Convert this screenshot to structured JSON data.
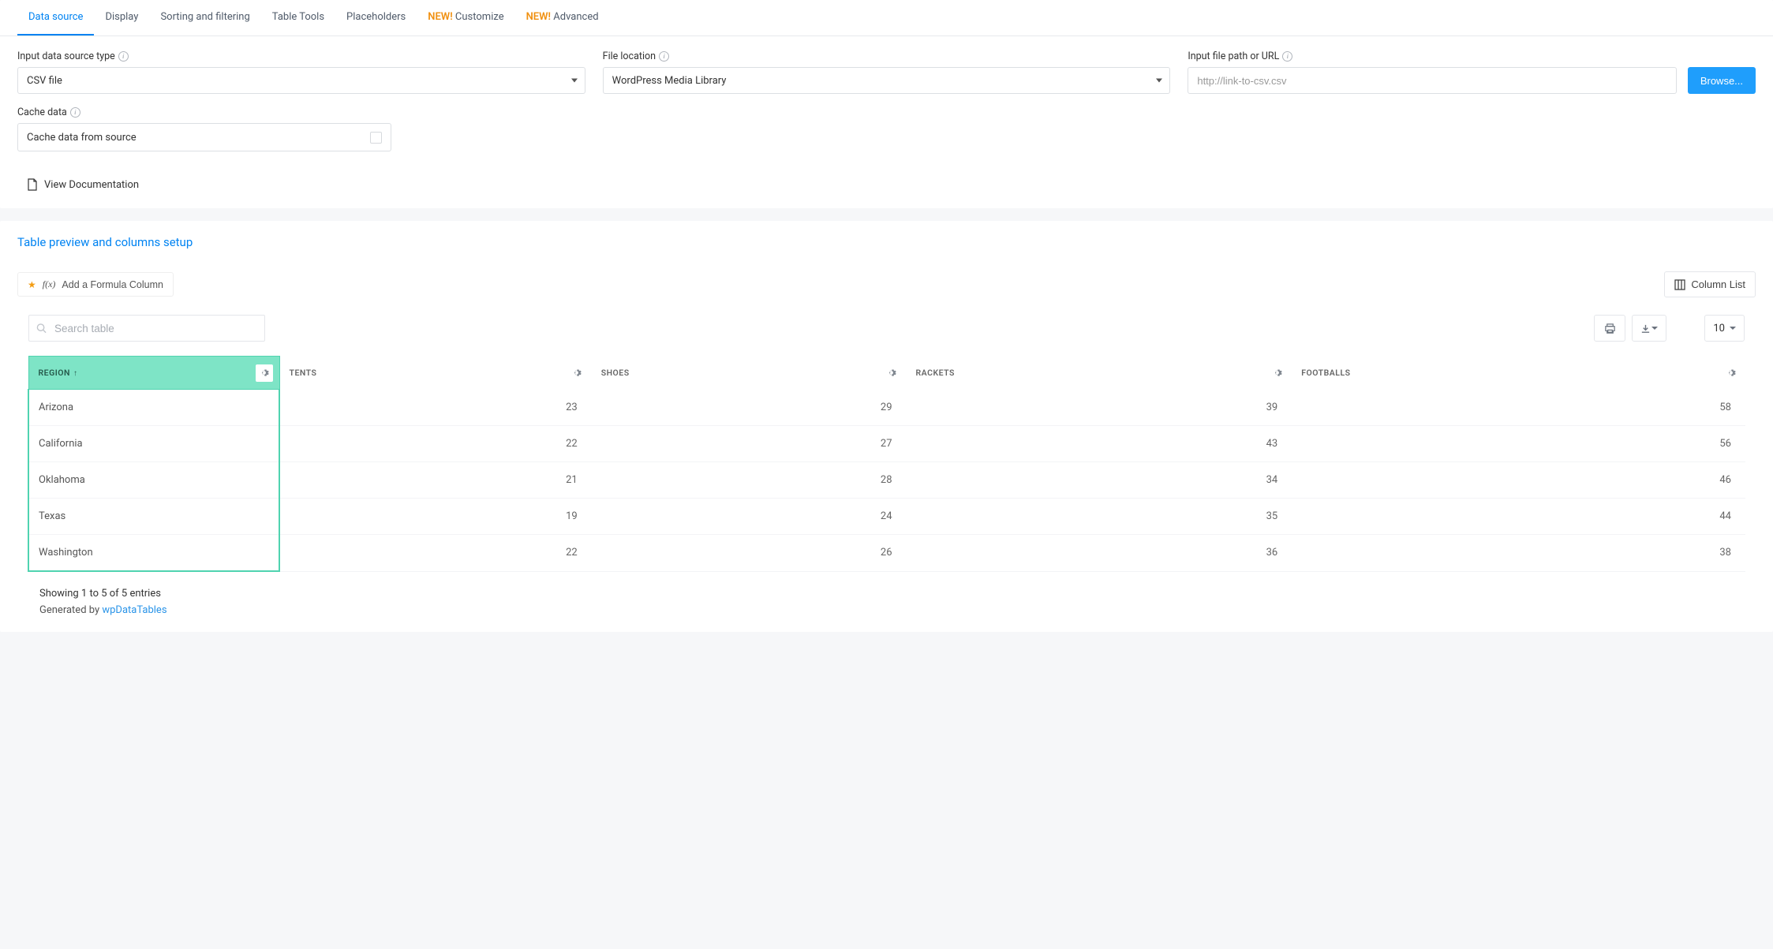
{
  "tabs": [
    {
      "label": "Data source",
      "active": true
    },
    {
      "label": "Display"
    },
    {
      "label": "Sorting and filtering"
    },
    {
      "label": "Table Tools"
    },
    {
      "label": "Placeholders"
    },
    {
      "label": "Customize",
      "new": "NEW!"
    },
    {
      "label": "Advanced",
      "new": "NEW!"
    }
  ],
  "labels": {
    "source_type": "Input data source type",
    "file_location": "File location",
    "file_path": "Input file path or URL",
    "cache": "Cache data",
    "cache_box": "Cache data from source",
    "view_docs": "View Documentation",
    "browse": "Browse...",
    "preview_title": "Table preview and columns setup",
    "formula": "Add a Formula Column",
    "column_list": "Column List",
    "search_placeholder": "Search table",
    "page_size": "10",
    "showing": "Showing 1 to 5 of 5 entries",
    "generated": "Generated by ",
    "generated_link": "wpDataTables"
  },
  "selects": {
    "source_type": "CSV file",
    "file_location": "WordPress Media Library"
  },
  "file_path_value": "http://link-to-csv.csv",
  "table": {
    "columns": [
      "REGION",
      "TENTS",
      "SHOES",
      "RACKETS",
      "FOOTBALLS"
    ],
    "rows": [
      {
        "region": "Arizona",
        "tents": "23",
        "shoes": "29",
        "rackets": "39",
        "footballs": "58"
      },
      {
        "region": "California",
        "tents": "22",
        "shoes": "27",
        "rackets": "43",
        "footballs": "56"
      },
      {
        "region": "Oklahoma",
        "tents": "21",
        "shoes": "28",
        "rackets": "34",
        "footballs": "46"
      },
      {
        "region": "Texas",
        "tents": "19",
        "shoes": "24",
        "rackets": "35",
        "footballs": "44"
      },
      {
        "region": "Washington",
        "tents": "22",
        "shoes": "26",
        "rackets": "36",
        "footballs": "38"
      }
    ]
  }
}
